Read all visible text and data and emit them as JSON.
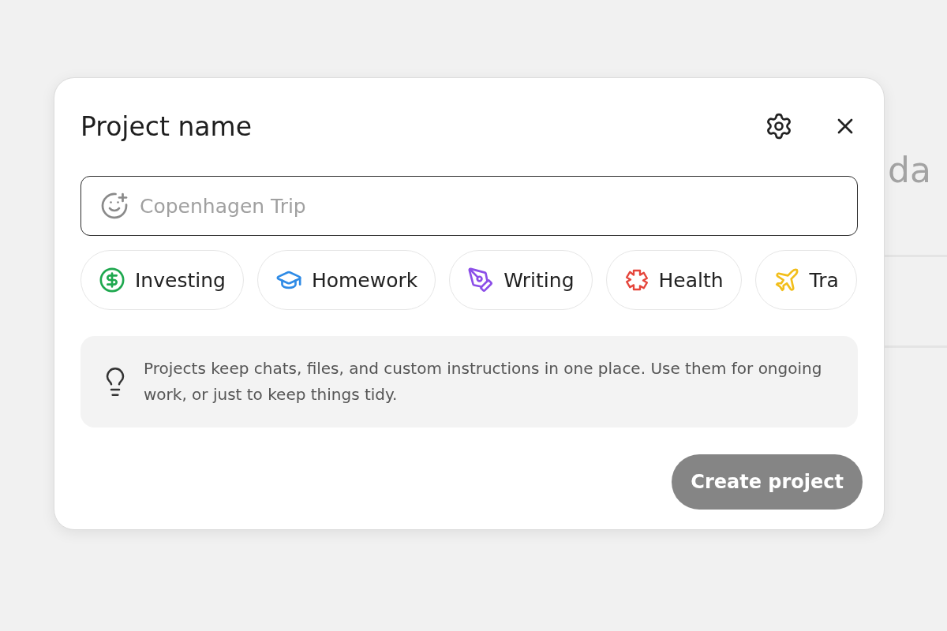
{
  "background": {
    "heading": "da"
  },
  "dialog": {
    "title": "Project name",
    "name_field": {
      "placeholder": "Copenhagen Trip"
    },
    "categories": [
      {
        "label": "Investing",
        "color": "#1fa84f"
      },
      {
        "label": "Homework",
        "color": "#2f8be6"
      },
      {
        "label": "Writing",
        "color": "#8c4fe8"
      },
      {
        "label": "Health",
        "color": "#e5453b"
      },
      {
        "label": "Tra",
        "color": "#f2be1a"
      }
    ],
    "tip": "Projects keep chats, files, and custom instructions in one place. Use them for ongoing work, or just to keep things tidy.",
    "create_button": {
      "label": "Create project",
      "disabled": true
    }
  }
}
